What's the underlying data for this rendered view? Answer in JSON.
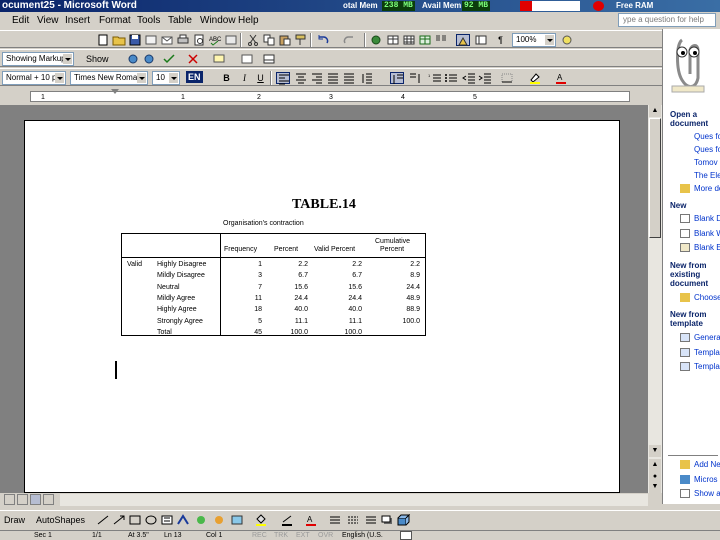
{
  "window": {
    "title": "ocument25 - Microsoft Word",
    "mem_total_label": "otal Mem",
    "mem_total_value": "238 MB",
    "mem_avail_label": "Avail Mem",
    "mem_avail_value": "92 MB",
    "tb_right": "Free RAM"
  },
  "menu": {
    "items": [
      "Edit",
      "View",
      "Insert",
      "Format",
      "Tools",
      "Table",
      "Window",
      "Help"
    ],
    "help_placeholder": "ype a question for help"
  },
  "toolbar_std": {
    "zoom": "100%"
  },
  "toolbar_review": {
    "markup": "Showing Markup",
    "show": "Show"
  },
  "toolbar_fmt": {
    "style": "Normal + 10 pt",
    "font": "Times New Roman",
    "size": "10",
    "lang": "EN"
  },
  "ruler": {
    "ticks": [
      "1",
      "1",
      "2",
      "3",
      "4",
      "5"
    ]
  },
  "document": {
    "table_title": "TABLE.14",
    "caption": "Organisation's contraction",
    "table": {
      "header_cumulative": "Cumulative",
      "header_percent2": "Percent",
      "columns": [
        "Frequency",
        "Percent",
        "Valid Percent"
      ],
      "group_label": "Valid",
      "rows": [
        {
          "label": "Highly Disagree",
          "freq": "1",
          "pct": "2.2",
          "valid": "2.2",
          "cum": "2.2"
        },
        {
          "label": "Mildly Disagree",
          "freq": "3",
          "pct": "6.7",
          "valid": "6.7",
          "cum": "8.9"
        },
        {
          "label": "Neutral",
          "freq": "7",
          "pct": "15.6",
          "valid": "15.6",
          "cum": "24.4"
        },
        {
          "label": "Mildly Agree",
          "freq": "11",
          "pct": "24.4",
          "valid": "24.4",
          "cum": "48.9"
        },
        {
          "label": "Highly Agree",
          "freq": "18",
          "pct": "40.0",
          "valid": "40.0",
          "cum": "88.9"
        },
        {
          "label": "Strongly Agree",
          "freq": "5",
          "pct": "11.1",
          "valid": "11.1",
          "cum": "100.0"
        },
        {
          "label": "Total",
          "freq": "45",
          "pct": "100.0",
          "valid": "100.0",
          "cum": ""
        }
      ]
    }
  },
  "taskpane": {
    "open_heading": "Open a document",
    "open_links": [
      "Ques for",
      "Ques for",
      "Tomov",
      "The Ele"
    ],
    "more_docs": "More do",
    "new_heading": "New",
    "new_links": [
      "Blank D",
      "Blank W",
      "Blank E"
    ],
    "existing_heading": "New from existing document",
    "existing_link": "Choose",
    "template_heading": "New from template",
    "template_links": [
      "Genera",
      "Templa",
      "Templa"
    ],
    "bottom_links": [
      "Add Ne",
      "Micros",
      "Show a"
    ]
  },
  "drawbar": {
    "draw": "Draw",
    "autoshapes": "AutoShapes"
  },
  "status": {
    "sec": "Sec 1",
    "page": "1/1",
    "at": "At 3.5\"",
    "ln": "Ln 13",
    "col": "Col 1",
    "rec": "REC",
    "trk": "TRK",
    "ext": "EXT",
    "ovr": "OVR",
    "lang": "English (U.S."
  }
}
